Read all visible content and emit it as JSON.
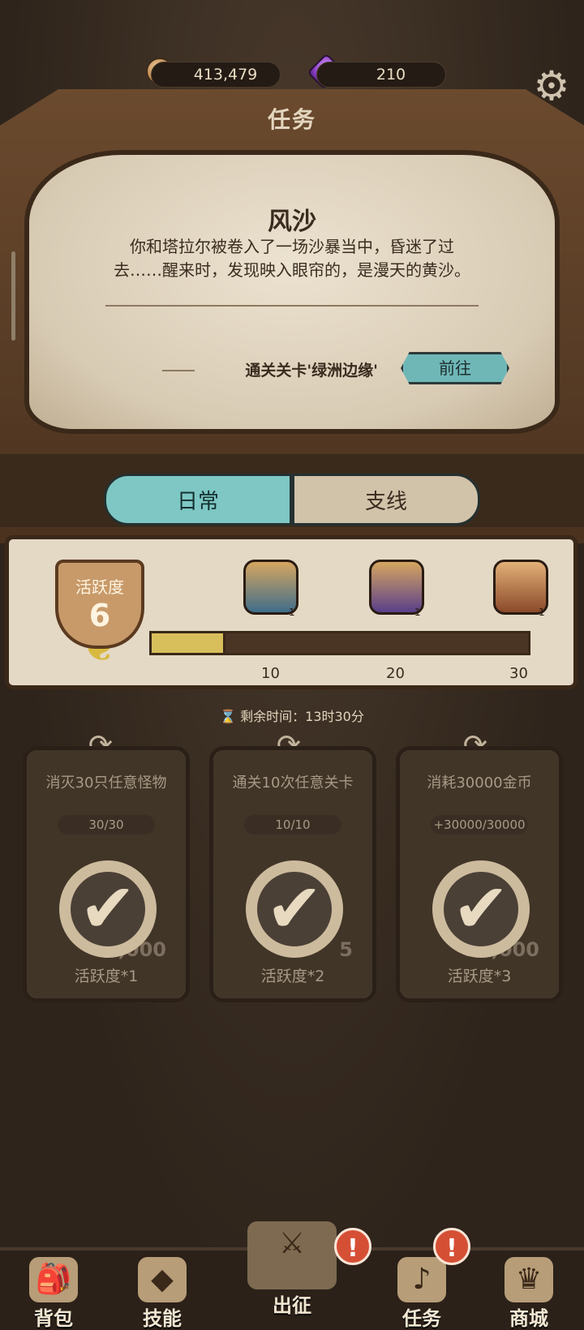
{
  "resources": {
    "gold": "413,479",
    "gems": "210",
    "gold_icon": "coin-icon",
    "gem_icon": "crystal-icon"
  },
  "header": {
    "title": "任务",
    "settings_icon": "gear-icon"
  },
  "story": {
    "title": "风沙",
    "text": "你和塔拉尔被卷入了一场沙暴当中，昏迷了过去……醒来时，发现映入眼帘的，是漫天的黄沙。",
    "goal": "通关关卡'绿洲边缘'",
    "go_button": "前往"
  },
  "tabs": {
    "daily": "日常",
    "branch": "支线"
  },
  "activity": {
    "label": "活跃度",
    "value": "6",
    "progress_fraction": 0.2,
    "max": 30,
    "milestones": [
      {
        "label": "10",
        "chest_count": "1",
        "chest_icon": "blue-chest-icon"
      },
      {
        "label": "20",
        "chest_count": "1",
        "chest_icon": "purple-chest-icon"
      },
      {
        "label": "30",
        "chest_count": "1",
        "chest_icon": "orange-chest-icon"
      }
    ]
  },
  "timer": {
    "text": "剩余时间：13时30分",
    "icon": "hourglass-icon"
  },
  "quests": [
    {
      "title": "消灭30只任意怪物",
      "progress": "30/30",
      "reward": "活跃度*1",
      "cost": "5,000"
    },
    {
      "title": "通关10次任意关卡",
      "progress": "10/10",
      "reward": "活跃度*2",
      "cost": "5"
    },
    {
      "title": "消耗30000金币",
      "progress": "+30000/30000",
      "reward": "活跃度*3",
      "cost": "30,000"
    }
  ],
  "bottom_nav": [
    {
      "label": "背包",
      "icon": "backpack-icon"
    },
    {
      "label": "技能",
      "icon": "skill-book-icon"
    },
    {
      "label": "出征",
      "icon": "sword-map-icon"
    },
    {
      "label": "任务",
      "icon": "horn-icon"
    },
    {
      "label": "商城",
      "icon": "shop-crown-icon"
    }
  ],
  "colors": {
    "accent_tab": "#7ec7c4",
    "progress_fill": "#d9bf5c",
    "alert": "#d54f35"
  }
}
